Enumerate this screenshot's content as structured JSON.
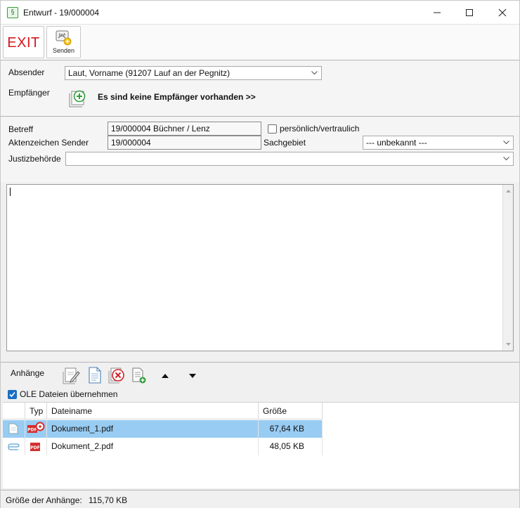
{
  "window": {
    "title": "Entwurf - 19/000004",
    "app_icon_glyph": "§"
  },
  "toolbar": {
    "exit_label": "EXIT",
    "send_label": "Senden"
  },
  "header": {
    "absender_label": "Absender",
    "absender_value": "Laut, Vorname (91207 Lauf an der Pegnitz)",
    "empfaenger_label": "Empfänger",
    "empfaenger_status": "Es sind keine Empfänger vorhanden >>"
  },
  "details": {
    "betreff_label": "Betreff",
    "betreff_value": "19/000004  Büchner / Lenz",
    "personal_label": "persönlich/vertraulich",
    "personal_checked": false,
    "aktenzeichen_label": "Aktenzeichen Sender",
    "aktenzeichen_value": "19/000004",
    "sachgebiet_label": "Sachgebiet",
    "sachgebiet_value": "--- unbekannt ---",
    "justiz_label": "Justizbehörde",
    "justiz_value": ""
  },
  "attachments": {
    "label": "Anhänge",
    "ole_label": "OLE Dateien übernehmen",
    "ole_checked": true,
    "columns": {
      "typ": "Typ",
      "name": "Dateiname",
      "size": "Größe"
    },
    "rows": [
      {
        "name": "Dokument_1.pdf",
        "size": "67,64 KB",
        "selected": true
      },
      {
        "name": "Dokument_2.pdf",
        "size": "48,05 KB",
        "selected": false
      }
    ]
  },
  "status": {
    "size_label": "Größe der Anhänge:",
    "size_value": "115,70 KB"
  },
  "colors": {
    "exit_red": "#d6161b",
    "selection_blue": "#99ccf3",
    "checkbox_blue": "#1a6fc4",
    "add_green": "#2e9d3a"
  }
}
